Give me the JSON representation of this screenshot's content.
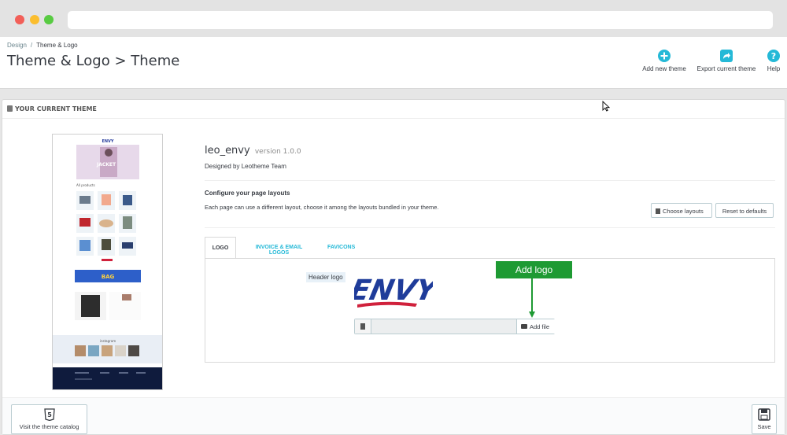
{
  "breadcrumb": {
    "parent": "Design",
    "separator": "/",
    "current": "Theme & Logo"
  },
  "page": {
    "title": "Theme & Logo > Theme"
  },
  "toolbar": {
    "add_label": "Add new theme",
    "export_label": "Export current theme",
    "help_label": "Help",
    "accent_color": "#25b9d7"
  },
  "panel": {
    "heading": "YOUR CURRENT THEME"
  },
  "theme": {
    "name": "leo_envy",
    "version": "version 1.0.0",
    "designer": "Designed by Leotheme Team",
    "preview": {
      "logo_text": "ENVY",
      "products_label": "All products",
      "bag_text": "BAG",
      "instagram_label": "instagram"
    }
  },
  "layouts": {
    "title": "Configure your page layouts",
    "description": "Each page can use a different layout, choose it among the layouts bundled in your theme.",
    "choose_label": "Choose layouts",
    "reset_label": "Reset to defaults"
  },
  "tabs": [
    {
      "label": "LOGO",
      "active": true
    },
    {
      "label": "INVOICE & EMAIL LOGOS",
      "active": false
    },
    {
      "label": "FAVICONS",
      "active": false
    }
  ],
  "logo_tab": {
    "header_logo_label": "Header logo",
    "logo_text": "ENVY",
    "add_file_label": "Add file",
    "callout_label": "Add logo",
    "callout_color": "#1e9a33"
  },
  "footer": {
    "catalog_label": "Visit the theme catalog",
    "save_label": "Save"
  }
}
